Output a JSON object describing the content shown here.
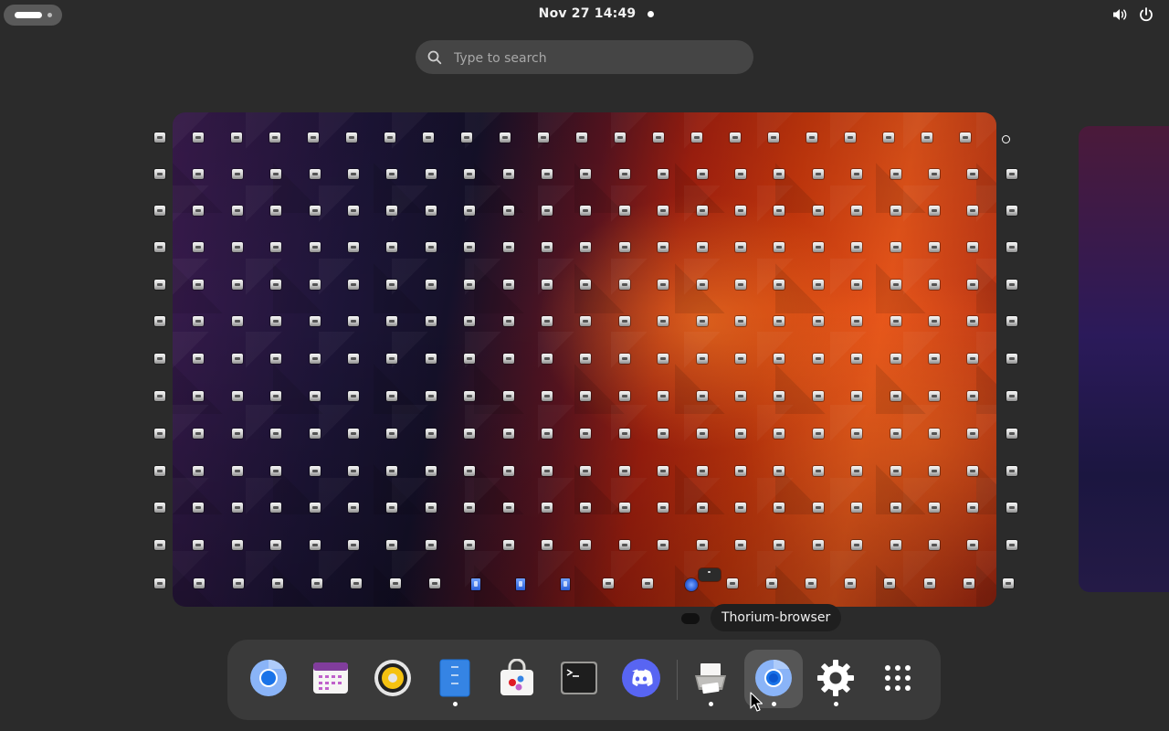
{
  "top_bar": {
    "clock": "Nov 27  14:49",
    "tray": [
      "volume-icon",
      "power-icon"
    ]
  },
  "search": {
    "placeholder": "Type to search"
  },
  "workspace": {
    "desktop_icon": "file-thumbnail-icon"
  },
  "tooltip": {
    "text": "Thorium-browser"
  },
  "dock": {
    "apps": [
      {
        "name": "Chromium",
        "icon": "chromium-icon",
        "running": false
      },
      {
        "name": "Calendar",
        "icon": "calendar-icon",
        "running": false
      },
      {
        "name": "Rhythmbox",
        "icon": "music-player-icon",
        "running": false
      },
      {
        "name": "Text Editor",
        "icon": "text-editor-icon",
        "running": true
      },
      {
        "name": "Software",
        "icon": "software-store-icon",
        "running": false
      },
      {
        "name": "Terminal",
        "icon": "terminal-icon",
        "running": false
      },
      {
        "name": "Discord",
        "icon": "discord-icon",
        "running": false
      },
      {
        "name": "Printer",
        "icon": "printer-icon",
        "running": true
      },
      {
        "name": "Thorium-browser",
        "icon": "thorium-browser-icon",
        "running": true,
        "hovered": true
      },
      {
        "name": "Settings",
        "icon": "settings-gear-icon",
        "running": true
      },
      {
        "name": "Show Apps",
        "icon": "app-grid-icon",
        "running": false
      }
    ]
  }
}
